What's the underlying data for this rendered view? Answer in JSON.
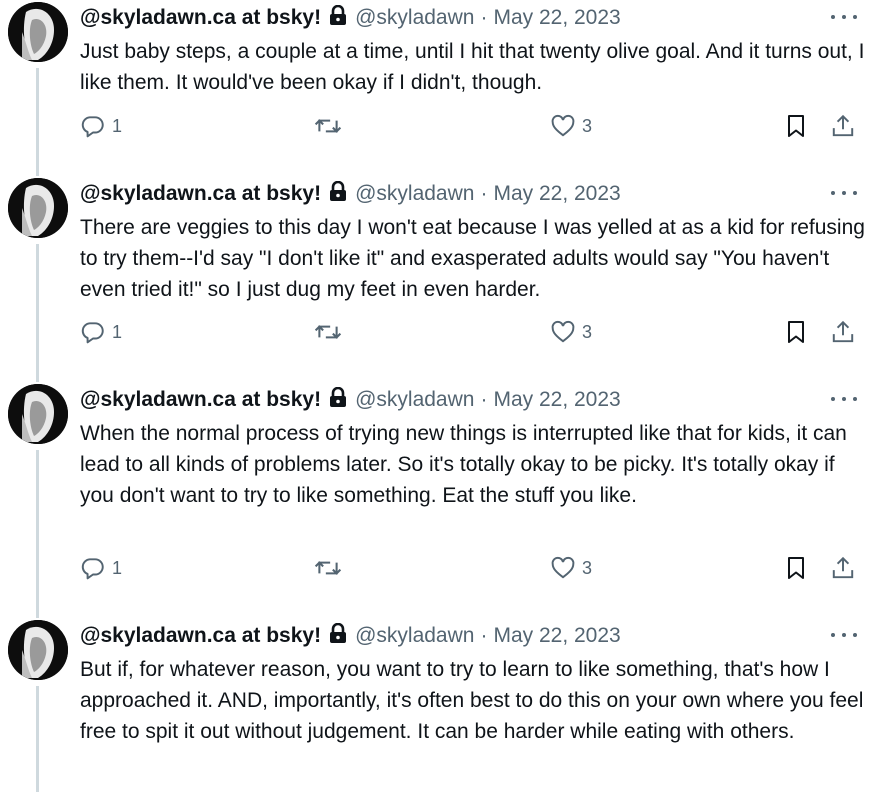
{
  "colors": {
    "text": "#0f1419",
    "secondary": "#536471",
    "thread_line": "#cfd9de"
  },
  "tweets": [
    {
      "display_name": "@skyladawn.ca at bsky!",
      "handle": "@skyladawn",
      "separator": "·",
      "date": "May 22, 2023",
      "text": "Just baby steps, a couple at a time, until I hit that twenty olive goal. And it turns out, I like them. It would've been okay if I didn't, though.",
      "replies": "1",
      "likes": "3"
    },
    {
      "display_name": "@skyladawn.ca at bsky!",
      "handle": "@skyladawn",
      "separator": "·",
      "date": "May 22, 2023",
      "text": "There are veggies to this day I won't eat because I was yelled at as a kid for refusing to try them--I'd say \"I don't like it\" and exasperated adults would say \"You haven't even tried it!\" so I just dug my feet in even harder.",
      "replies": "1",
      "likes": "3"
    },
    {
      "display_name": "@skyladawn.ca at bsky!",
      "handle": "@skyladawn",
      "separator": "·",
      "date": "May 22, 2023",
      "text": "When the normal process of trying new things is interrupted like that for kids, it can lead to all kinds of problems later. So it's totally okay to be picky. It's totally okay if you don't want to try to like something. Eat the stuff you like.",
      "replies": "1",
      "likes": "3"
    },
    {
      "display_name": "@skyladawn.ca at bsky!",
      "handle": "@skyladawn",
      "separator": "·",
      "date": "May 22, 2023",
      "text": "But if, for whatever reason, you want to try to learn to like something, that's how I approached it. AND, importantly, it's often best to do this on your own where you feel free to spit it out without judgement. It can be harder while eating with others."
    }
  ]
}
